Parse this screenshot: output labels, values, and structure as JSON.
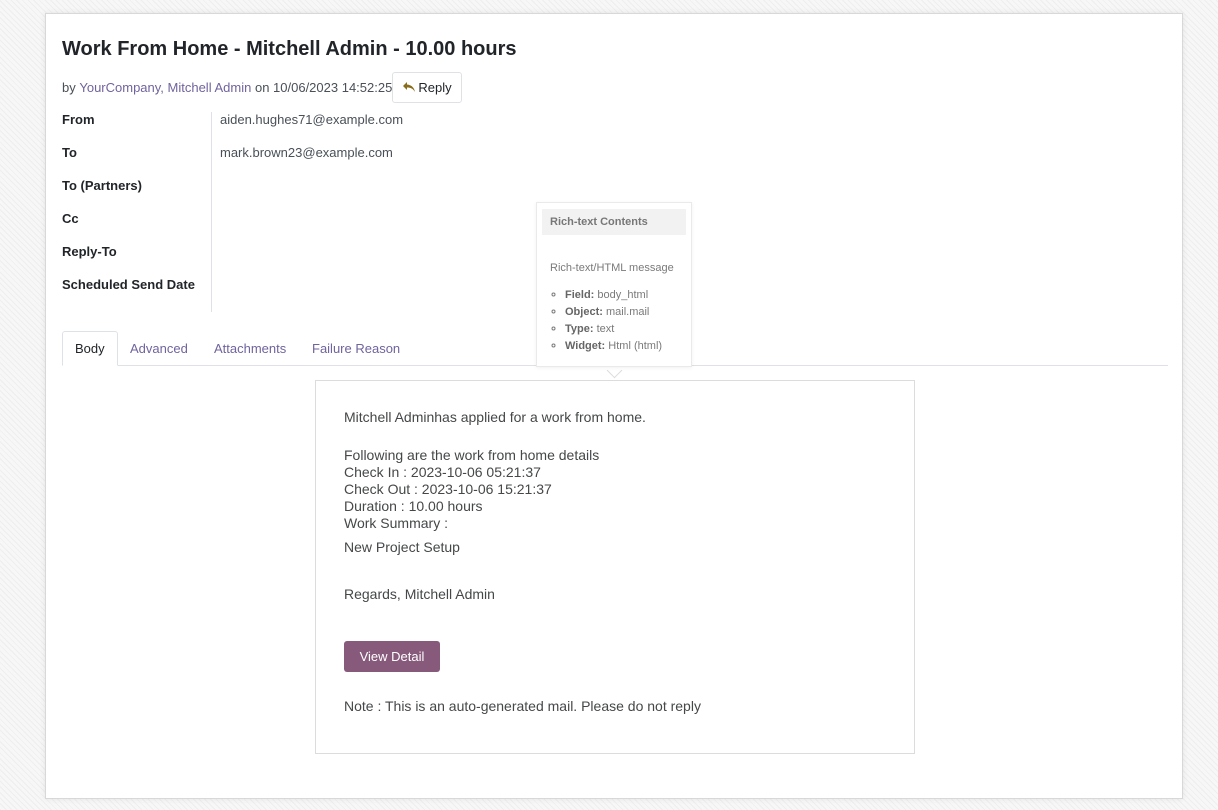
{
  "mail": {
    "title": "Work From Home - Mitchell Admin - 10.00 hours",
    "byline": {
      "prefix": "by",
      "authors": "YourCompany, Mitchell Admin",
      "on_text": "on 10/06/2023 14:52:25"
    },
    "reply_label": "Reply"
  },
  "fields": [
    {
      "label": "From",
      "value": "aiden.hughes71@example.com"
    },
    {
      "label": "To",
      "value": "mark.brown23@example.com"
    },
    {
      "label": "To (Partners)",
      "value": ""
    },
    {
      "label": "Cc",
      "value": ""
    },
    {
      "label": "Reply-To",
      "value": ""
    },
    {
      "label": "Scheduled Send Date",
      "value": ""
    }
  ],
  "tabs": [
    "Body",
    "Advanced",
    "Attachments",
    "Failure Reason"
  ],
  "active_tab": "Body",
  "tooltip": {
    "title": "Rich-text Contents",
    "description": "Rich-text/HTML message",
    "items": [
      {
        "key": "Field:",
        "value": "body_html"
      },
      {
        "key": "Object:",
        "value": "mail.mail"
      },
      {
        "key": "Type:",
        "value": "text"
      },
      {
        "key": "Widget:",
        "value": "Html (html)"
      }
    ]
  },
  "body": {
    "intro": "Mitchell Adminhas applied for a work from home.",
    "details_heading": "Following are the work from home details",
    "check_in": "Check In : 2023-10-06 05:21:37",
    "check_out": "Check Out : 2023-10-06 15:21:37",
    "duration": "Duration : 10.00 hours",
    "summary_label": "Work Summary :",
    "summary": "New Project Setup",
    "regards": "Regards, Mitchell Admin",
    "button_label": "View Detail",
    "note": "Note : This is an auto-generated mail. Please do not reply"
  },
  "colors": {
    "link": "#71639e",
    "primary_button": "#875a7b",
    "reply_icon": "#8a6d1c"
  }
}
